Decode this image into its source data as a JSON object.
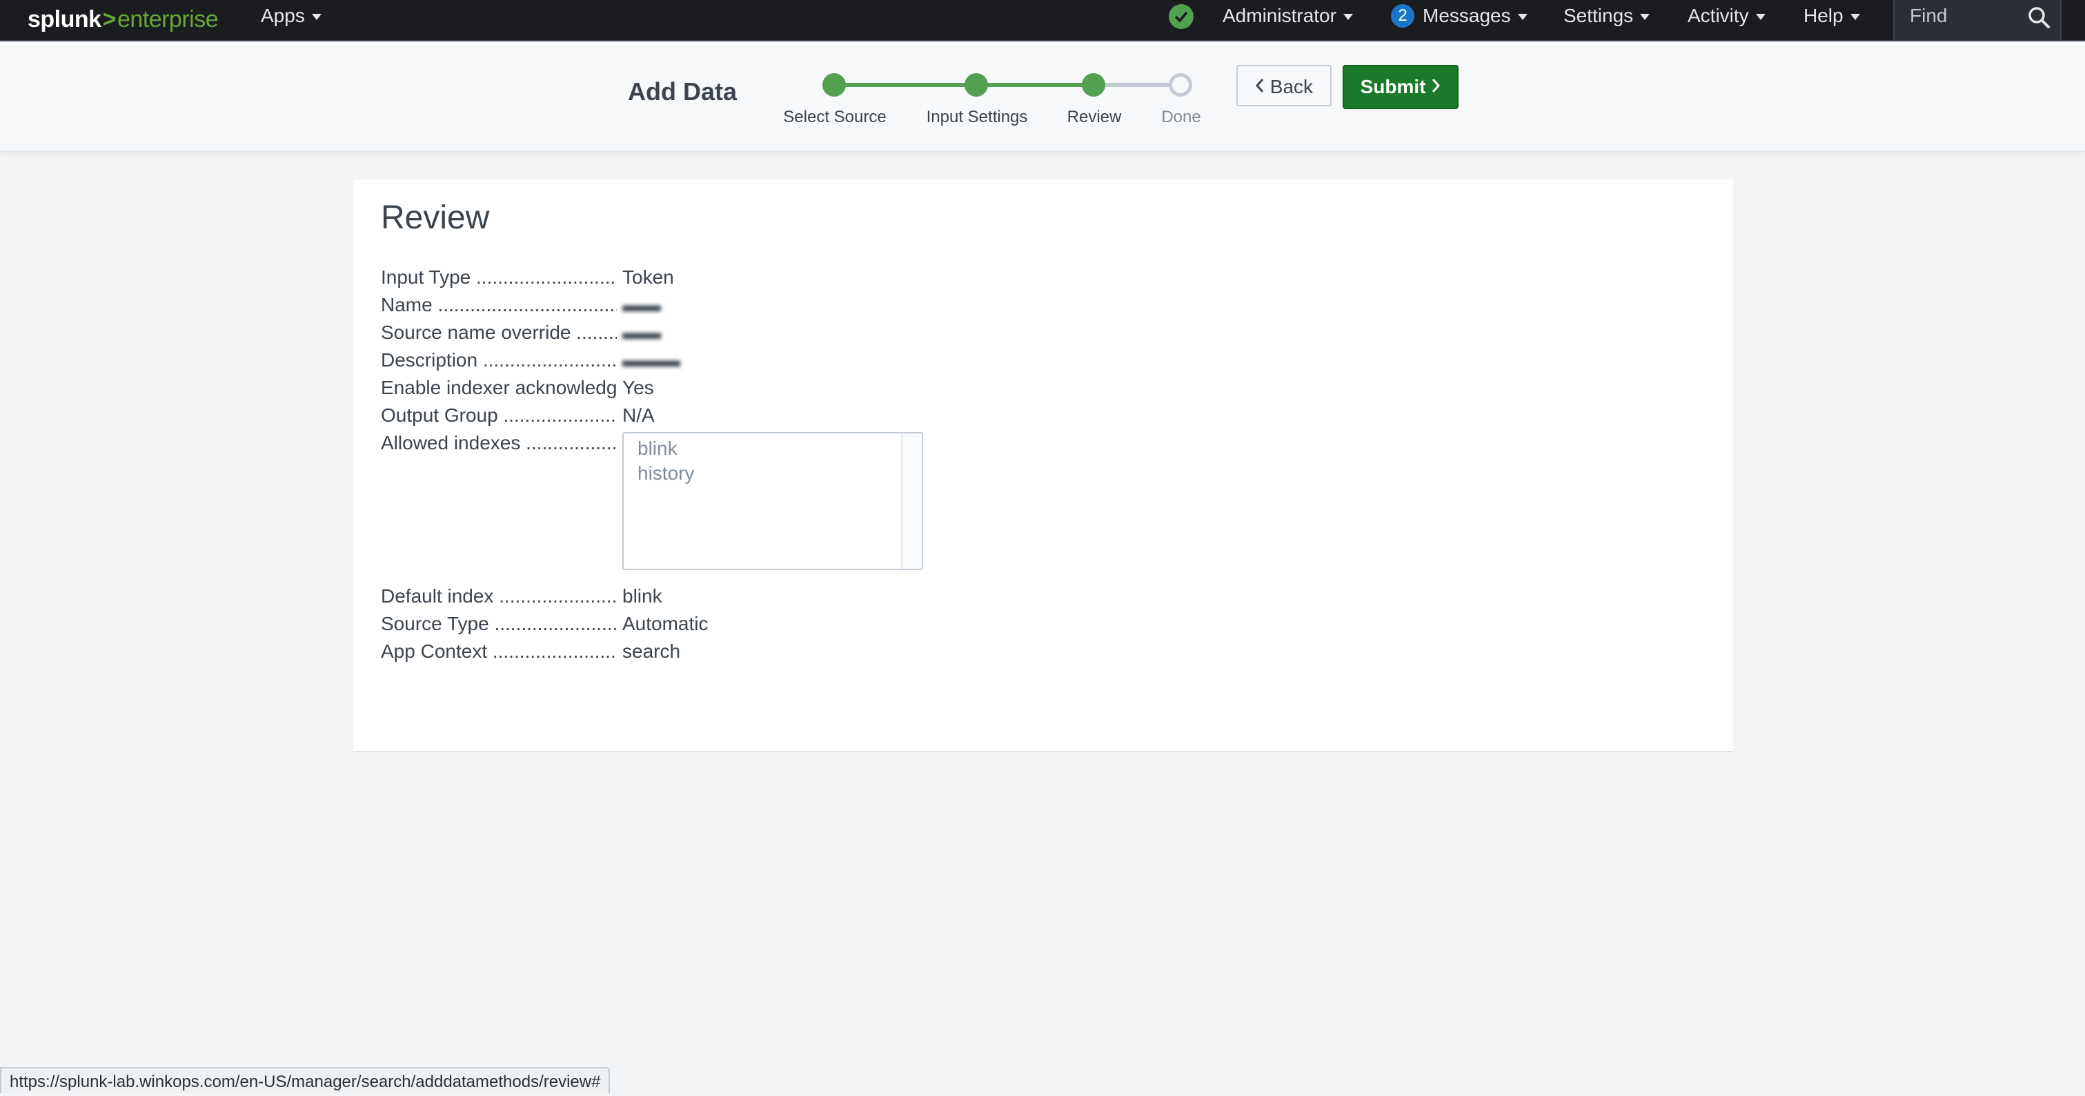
{
  "topbar": {
    "logo_part1": "splunk",
    "logo_sep": ">",
    "logo_part2": "enterprise",
    "apps_label": "Apps",
    "status_icon": "check-circle-icon",
    "user_label": "Administrator",
    "messages_count": "2",
    "messages_label": "Messages",
    "settings_label": "Settings",
    "activity_label": "Activity",
    "help_label": "Help",
    "find_placeholder": "Find",
    "colors": {
      "bar": "#1a1c20",
      "brand_green": "#65a637",
      "badge_blue": "#1a76c9"
    }
  },
  "wizard": {
    "title": "Add Data",
    "steps": [
      {
        "label": "Select Source",
        "state": "complete"
      },
      {
        "label": "Input Settings",
        "state": "complete"
      },
      {
        "label": "Review",
        "state": "current"
      },
      {
        "label": "Done",
        "state": "pending"
      }
    ],
    "back_label": "Back",
    "submit_label": "Submit",
    "colors": {
      "step_done": "#53a051",
      "submit_bg": "#1a7a2a"
    }
  },
  "review": {
    "title": "Review",
    "fields": [
      {
        "key": "Input Type ................................",
        "value": "Token"
      },
      {
        "key": "Name ........................................",
        "value": "▬▬",
        "blurred": true
      },
      {
        "key": "Source name override .........",
        "value": "▬▬",
        "blurred": true
      },
      {
        "key": "Description ..............................",
        "value": "▬▬▬",
        "blurred": true
      },
      {
        "key": "Enable indexer acknowledg",
        "value": "Yes"
      },
      {
        "key": "Output Group ........................",
        "value": "N/A"
      },
      {
        "key": "Allowed indexes ...................",
        "value": ""
      },
      {
        "key": "Default index .........................",
        "value": "blink"
      },
      {
        "key": "Source Type ...........................",
        "value": "Automatic"
      },
      {
        "key": "App Context ...........................",
        "value": "search"
      }
    ],
    "allowed_indexes": [
      "blink",
      "history"
    ]
  },
  "status_url": "https://splunk-lab.winkops.com/en-US/manager/search/adddatamethods/review#"
}
